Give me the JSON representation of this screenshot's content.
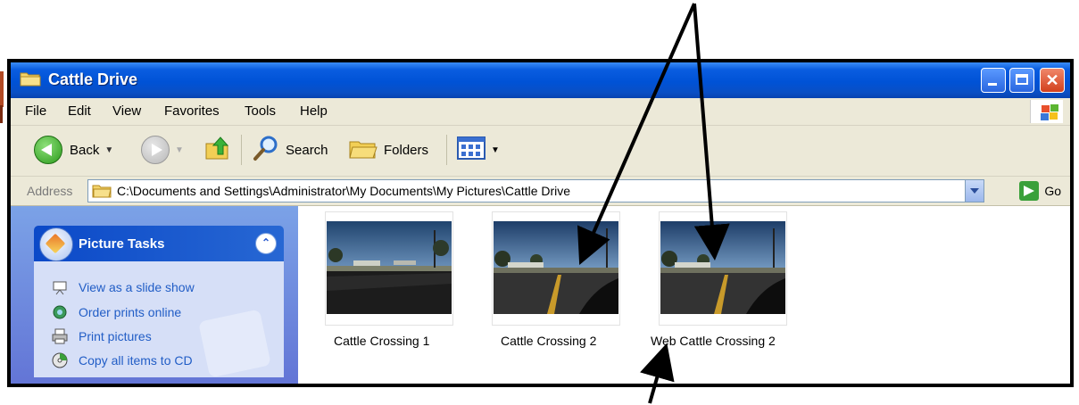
{
  "window": {
    "title": "Cattle Drive"
  },
  "menubar": {
    "items": [
      "File",
      "Edit",
      "View",
      "Favorites",
      "Tools",
      "Help"
    ]
  },
  "toolbar": {
    "back_label": "Back",
    "search_label": "Search",
    "folders_label": "Folders"
  },
  "address": {
    "label": "Address",
    "path": "C:\\Documents and Settings\\Administrator\\My Documents\\My Pictures\\Cattle Drive",
    "go_label": "Go"
  },
  "tasks_panel": {
    "title": "Picture Tasks",
    "items": [
      {
        "label": "View as a slide show",
        "icon": "slideshow-icon"
      },
      {
        "label": "Order prints online",
        "icon": "globe-icon"
      },
      {
        "label": "Print pictures",
        "icon": "printer-icon"
      },
      {
        "label": "Copy all items to CD",
        "icon": "cd-icon"
      }
    ]
  },
  "files": [
    {
      "name": "Cattle Crossing 1"
    },
    {
      "name": "Cattle Crossing 2"
    },
    {
      "name": "Web Cattle Crossing 2"
    }
  ],
  "colors": {
    "titlebar": "#0052d6",
    "sidebar": "#7ba2e7",
    "task_link": "#215dc6",
    "close_button": "#d2401c"
  }
}
